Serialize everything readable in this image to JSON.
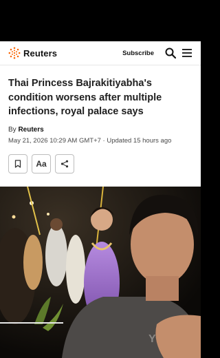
{
  "brand": {
    "name": "Reuters",
    "logo_icon": "reuters-dot-logo",
    "accent": "#fa6400"
  },
  "header": {
    "subscribe_label": "Subscribe",
    "search_icon": "search-icon",
    "menu_icon": "hamburger-menu-icon"
  },
  "article": {
    "headline": "Thai Princess Bajrakitiyabha's condition worsens after multiple infections, royal palace says",
    "byline_prefix": "By",
    "byline_author": "Reuters",
    "dateline": "May 21, 2026 10:29 AM GMT+7 · Updated 15 hours ago"
  },
  "actions": {
    "bookmark_icon": "bookmark-icon",
    "text_size_label": "Aa",
    "share_icon": "share-icon"
  },
  "media": {
    "description": "video"
  }
}
